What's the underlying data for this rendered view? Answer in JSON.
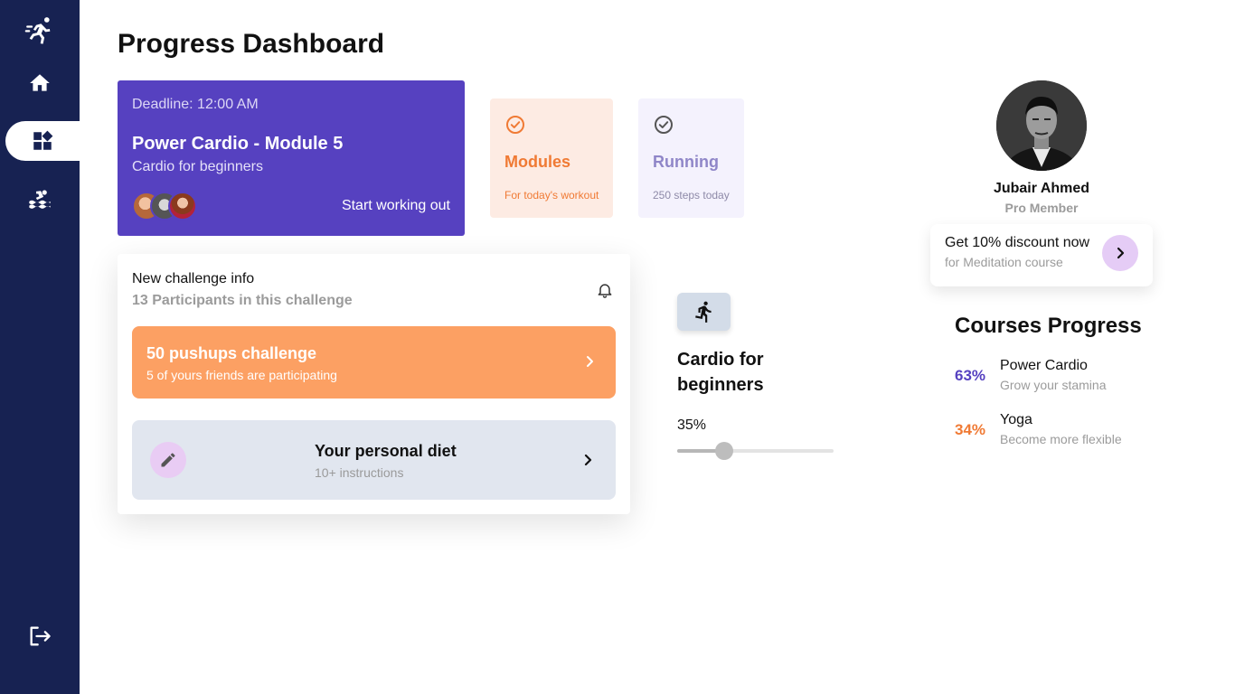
{
  "page": {
    "title": "Progress Dashboard"
  },
  "sidebar": {
    "items": [
      {
        "icon": "runner-logo-icon"
      },
      {
        "icon": "home-icon"
      },
      {
        "icon": "dashboard-icon",
        "active": true
      },
      {
        "icon": "swimming-icon"
      },
      {
        "icon": "logout-icon"
      }
    ]
  },
  "workout_card": {
    "deadline": "Deadline: 12:00 AM",
    "title": "Power Cardio - Module 5",
    "subtitle": "Cardio for beginners",
    "cta": "Start working out",
    "color": "#5641c0"
  },
  "mini_cards": [
    {
      "title": "Modules",
      "subtitle": "For today's workout",
      "color": "#f07a34"
    },
    {
      "title": "Running",
      "subtitle": "250 steps today",
      "color": "#8f86c8"
    }
  ],
  "challenge": {
    "title": "New challenge info",
    "subtitle": "13 Participants in this challenge",
    "push": {
      "title": "50 pushups challenge",
      "subtitle": "5 of yours friends are participating",
      "color": "#fca063"
    },
    "diet": {
      "title": "Your personal diet",
      "subtitle": "10+ instructions"
    }
  },
  "cardio_progress": {
    "title": "Cardio for beginners",
    "percent_label": "35%",
    "value": 0.3
  },
  "profile": {
    "name": "Jubair Ahmed",
    "role": "Pro Member"
  },
  "discount": {
    "title": "Get 10% discount now",
    "subtitle": "for Meditation course"
  },
  "courses": {
    "title": "Courses Progress",
    "items": [
      {
        "percent": "63%",
        "name": "Power Cardio",
        "desc": "Grow your stamina",
        "color": "#5641c0"
      },
      {
        "percent": "34%",
        "name": "Yoga",
        "desc": "Become more flexible",
        "color": "#f07a34"
      }
    ]
  }
}
